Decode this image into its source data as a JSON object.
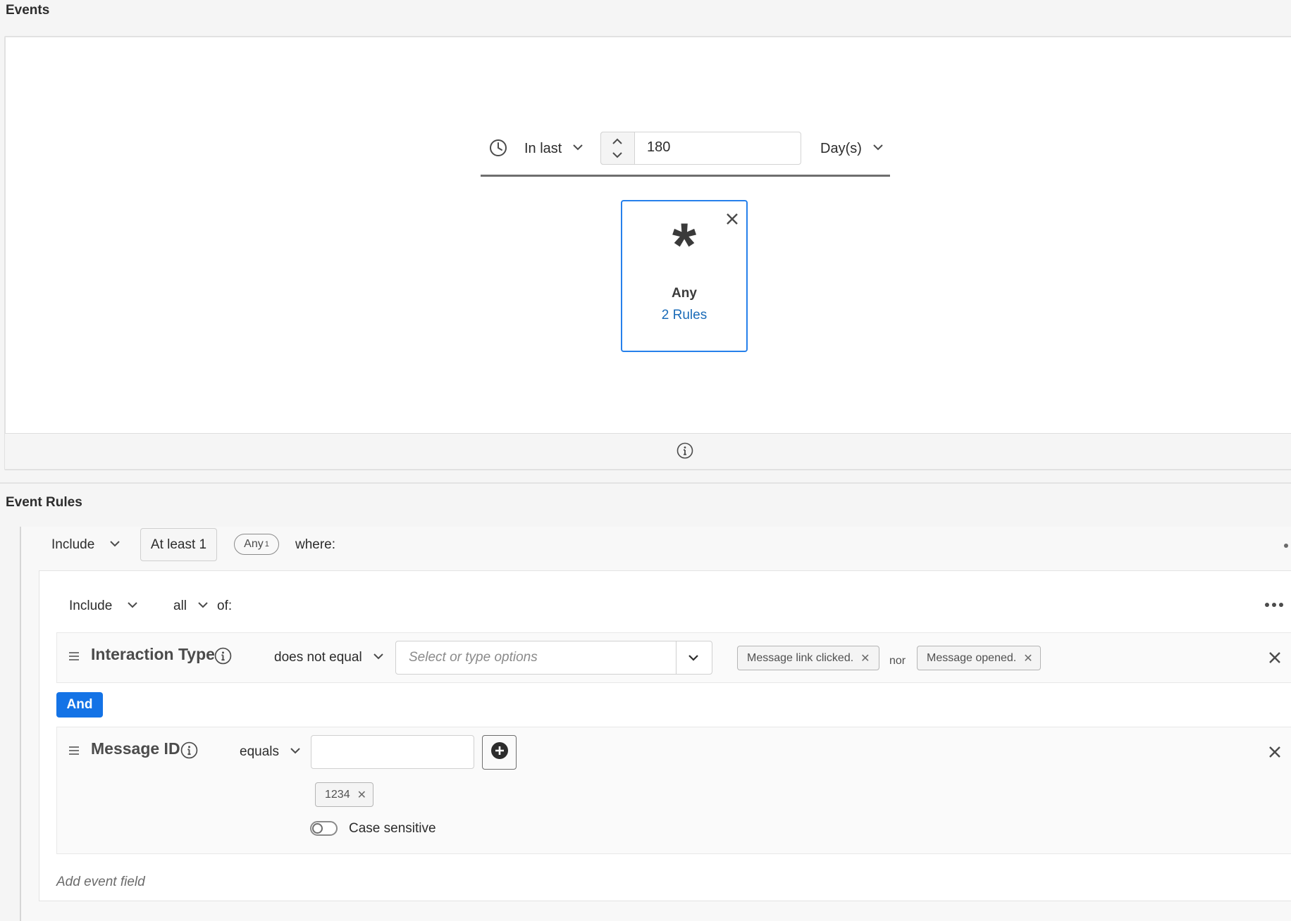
{
  "events": {
    "title": "Events",
    "time_operator": "In last",
    "time_value": "180",
    "time_unit": "Day(s)",
    "card": {
      "symbol": "*",
      "label": "Any",
      "rules_link": "2 Rules"
    }
  },
  "event_rules": {
    "title": "Event Rules",
    "outer_rule": {
      "mode": "Include",
      "quantity": "At least 1",
      "event_badge": "Any",
      "event_badge_count": "1",
      "suffix": "where:"
    },
    "group": {
      "mode": "Include",
      "quantifier": "all",
      "suffix": "of:",
      "conditions": [
        {
          "field": "Interaction Type",
          "operator": "does not equal",
          "placeholder": "Select or type options",
          "values": [
            "Message link clicked.",
            "Message opened."
          ],
          "joiner": "nor"
        },
        {
          "field": "Message ID",
          "operator": "equals",
          "input_value": "",
          "values": [
            "1234"
          ],
          "case_sensitive_label": "Case sensitive",
          "case_sensitive": false
        }
      ],
      "and_label": "And",
      "add_field_label": "Add event field"
    }
  },
  "colors": {
    "accent": "#1473e6",
    "card_border": "#2680eb",
    "link": "#1a6bb8"
  }
}
